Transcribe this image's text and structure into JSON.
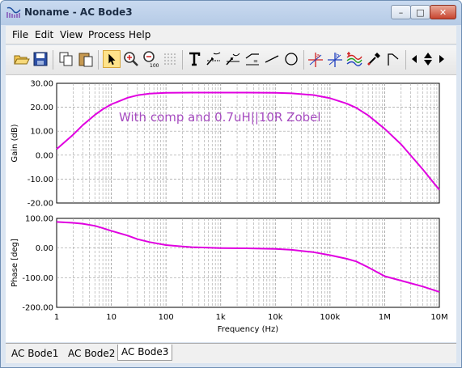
{
  "window": {
    "title": "Noname - AC Bode3"
  },
  "menu": [
    "File",
    "Edit",
    "View",
    "Process",
    "Help"
  ],
  "toolbar": {
    "buttons": [
      "open-folder-icon",
      "save-icon",
      "copy-icon",
      "paste-icon",
      "pointer-icon",
      "zoom-in-icon",
      "zoom-out-100-icon",
      "grid-dots-icon",
      "text-T-icon",
      "cursor-arrow-1-icon",
      "cursor-arrow-2-icon",
      "cursor-arrow-3-icon",
      "line-icon",
      "circle-icon",
      "marker-a-icon",
      "marker-b-icon",
      "add-curves-icon",
      "eyedropper-icon",
      "flag-icon",
      "left-arrow-icon",
      "up-down-icon",
      "right-arrow-icon"
    ]
  },
  "tabs": [
    "AC Bode1",
    "AC Bode2",
    "AC Bode3"
  ],
  "selected_tab": "AC Bode3",
  "colors": {
    "curve": "#e000e0",
    "annotation": "#a64cc0",
    "grid": "#a0a0a0"
  },
  "chart_data": [
    {
      "type": "line",
      "annotation": "With comp and 0.7uH||10R Zobel",
      "ylabel": "Gain (dB)",
      "xscale": "log",
      "xlim": [
        1,
        10000000
      ],
      "ylim": [
        -20,
        30
      ],
      "yticks": [
        "30.00",
        "20.00",
        "10.00",
        "0.00",
        "-10.00",
        "-20.00"
      ],
      "series": [
        {
          "x": [
            1,
            2,
            3,
            5,
            7,
            10,
            20,
            30,
            50,
            100,
            300,
            1000,
            3000,
            10000,
            20000,
            50000,
            100000,
            200000,
            300000,
            500000,
            1000000,
            2000000,
            5000000,
            10000000
          ],
          "y": [
            2.5,
            8.5,
            12.5,
            16.8,
            19.2,
            21.2,
            24.0,
            25.0,
            25.7,
            26.0,
            26.1,
            26.1,
            26.1,
            26.0,
            25.8,
            25.1,
            23.8,
            21.6,
            19.8,
            16.6,
            11.0,
            4.5,
            -6.0,
            -14.5
          ]
        }
      ]
    },
    {
      "type": "line",
      "ylabel": "Phase [deg]",
      "xlabel": "Frequency (Hz)",
      "xscale": "log",
      "xlim": [
        1,
        10000000
      ],
      "ylim": [
        -200,
        100
      ],
      "xticks": [
        "1",
        "10",
        "100",
        "1k",
        "10k",
        "100k",
        "1M",
        "10M"
      ],
      "yticks": [
        "100.00",
        "0.00",
        "-100.00",
        "-200.00"
      ],
      "series": [
        {
          "x": [
            1,
            2,
            3,
            5,
            7,
            10,
            20,
            30,
            50,
            100,
            200,
            300,
            1000,
            3000,
            10000,
            20000,
            30000,
            50000,
            100000,
            200000,
            300000,
            500000,
            1000000,
            2000000,
            5000000,
            10000000
          ],
          "y": [
            88,
            85,
            82,
            75,
            67,
            58,
            42,
            30,
            20,
            10,
            5,
            3,
            0,
            -1,
            -3,
            -6,
            -10,
            -14,
            -24,
            -36,
            -45,
            -65,
            -95,
            -110,
            -130,
            -148
          ]
        }
      ]
    }
  ]
}
